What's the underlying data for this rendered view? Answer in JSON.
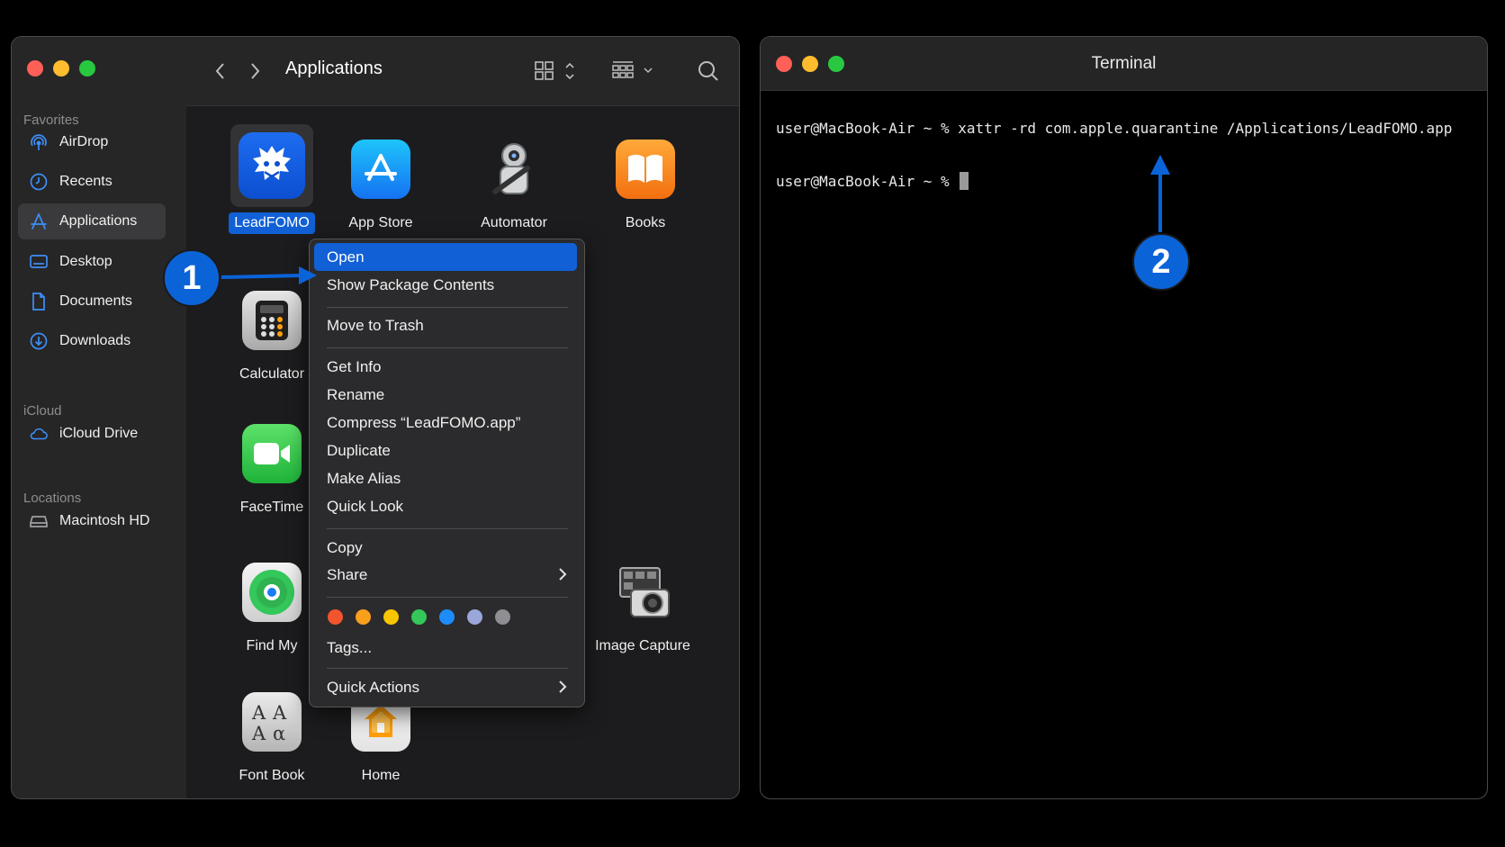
{
  "finder": {
    "title": "Applications",
    "traffic_lights": [
      "#ff5f57",
      "#febc2e",
      "#28c840"
    ],
    "sidebar": {
      "sections": [
        {
          "label": "Favorites",
          "items": [
            {
              "label": "AirDrop",
              "icon": "airdrop-icon"
            },
            {
              "label": "Recents",
              "icon": "clock-icon"
            },
            {
              "label": "Applications",
              "icon": "applications-icon",
              "selected": true
            },
            {
              "label": "Desktop",
              "icon": "desktop-icon"
            },
            {
              "label": "Documents",
              "icon": "document-icon"
            },
            {
              "label": "Downloads",
              "icon": "download-icon"
            }
          ]
        },
        {
          "label": "iCloud",
          "items": [
            {
              "label": "iCloud Drive",
              "icon": "cloud-icon"
            }
          ]
        },
        {
          "label": "Locations",
          "items": [
            {
              "label": "Macintosh HD",
              "icon": "drive-icon"
            }
          ]
        }
      ]
    },
    "apps": [
      {
        "name": "LeadFOMO",
        "selected": true
      },
      {
        "name": "App Store"
      },
      {
        "name": "Automator"
      },
      {
        "name": "Books"
      },
      {
        "name": "Calculator"
      },
      {
        "name": "FaceTime"
      },
      {
        "name": "Find My"
      },
      {
        "name": "Image Capture"
      },
      {
        "name": "Font Book"
      },
      {
        "name": "Home"
      }
    ],
    "context_menu": {
      "items": [
        {
          "label": "Open",
          "highlighted": true
        },
        {
          "label": "Show Package Contents"
        },
        {
          "label": "Move to Trash"
        },
        {
          "label": "Get Info"
        },
        {
          "label": "Rename"
        },
        {
          "label": "Compress “LeadFOMO.app”"
        },
        {
          "label": "Duplicate"
        },
        {
          "label": "Make Alias"
        },
        {
          "label": "Quick Look"
        },
        {
          "label": "Copy"
        },
        {
          "label": "Share",
          "submenu": true
        },
        {
          "label": "Tags..."
        },
        {
          "label": "Quick Actions",
          "submenu": true
        }
      ],
      "tag_colors": [
        "#f2542d",
        "#f8a01c",
        "#f7c600",
        "#34c759",
        "#1d8cf8",
        "#9aa7d8",
        "#8e8e93"
      ]
    }
  },
  "terminal": {
    "title": "Terminal",
    "lines": [
      "user@MacBook-Air ~ % xattr -rd com.apple.quarantine /Applications/LeadFOMO.app",
      "user@MacBook-Air ~ % "
    ]
  },
  "annotations": {
    "step1": "1",
    "step2": "2",
    "color": "#0b63d8"
  }
}
